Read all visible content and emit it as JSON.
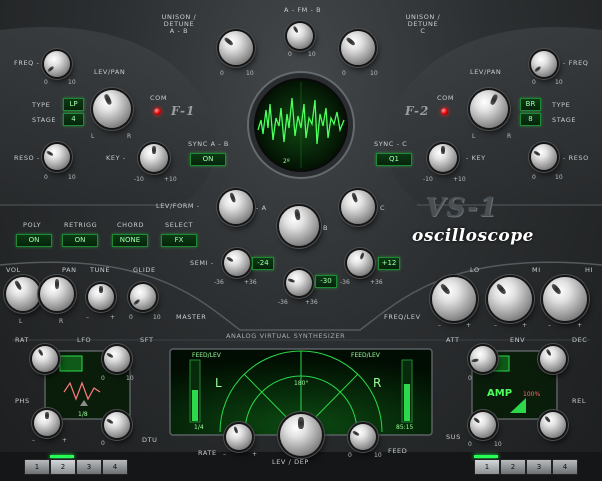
{
  "plugin": {
    "logo": "VS-1",
    "subtitle": "oscilloscope",
    "banner": "ANALOG  VIRTUAL  SYNTHESIZER",
    "scope_readout": "2º"
  },
  "osc": {
    "unison_ab": "UNISON / DETUNE\nA - B",
    "afmb": "A - FM - B",
    "unison_c": "UNISON / DETUNE\nC",
    "sync_ab_label": "SYNC A - B",
    "sync_ab_value": "ON",
    "sync_c_label": "SYNC - C",
    "sync_c_value": "Q1",
    "levform": "LEV/FORM -",
    "a": "- A",
    "b": "B",
    "c": "C",
    "semi": "SEMI -",
    "semi_a": "-24",
    "semi_b": "-30",
    "semi_c": "+12"
  },
  "filter1": {
    "name": "F-1",
    "freq": "FREQ -",
    "levpan": "LEV/PAN",
    "type": "TYPE",
    "stage": "STAGE",
    "type_value": "LP",
    "stage_value": "4",
    "com": "COM",
    "reso": "RESO -",
    "key": "KEY -"
  },
  "filter2": {
    "name": "F-2",
    "freq": "- FREQ",
    "levpan": "LEV/PAN",
    "type": "TYPE",
    "stage": "STAGE",
    "type_value": "BR",
    "stage_value": "8",
    "com": "COM",
    "reso": "- RESO",
    "key": "- KEY"
  },
  "mode": {
    "labels": [
      "POLY",
      "RETRIGG",
      "CHORD",
      "SELECT"
    ],
    "values": [
      "ON",
      "ON",
      "NONE",
      "FX"
    ]
  },
  "master": {
    "vol": "VOL",
    "pan": "PAN",
    "tune": "TUNE",
    "glide": "GLIDE",
    "master": "MASTER"
  },
  "eq": {
    "lo": "LO",
    "mi": "MI",
    "hi": "HI",
    "freqlev": "FREQ/LEV"
  },
  "lfo": {
    "rat": "RAT",
    "lfo": "LFO",
    "sft": "SFT",
    "phs": "PHS",
    "dtu": "DTU",
    "value": "1/8"
  },
  "fx": {
    "feed_l": "FEED/LEV",
    "feed_r": "FEED/LEV",
    "l": "L",
    "r": "R",
    "angle": "180°",
    "val_l": "1/4",
    "val_r": "85:15",
    "rate": "RATE",
    "levdep": "LEV / DEP",
    "feed": "FEED"
  },
  "env": {
    "att": "ATT",
    "env": "ENV",
    "dec": "DEC",
    "rel": "REL",
    "sus": "SUS",
    "amp": "AMP",
    "pct": "100%"
  },
  "tabs_left": [
    "1",
    "2",
    "3",
    "4"
  ],
  "tabs_right": [
    "1",
    "2",
    "3",
    "4"
  ],
  "scales": {
    "z": "0",
    "ten": "10",
    "m10": "-10",
    "p10": "+10",
    "m36": "-36",
    "p36": "+36",
    "m": "–",
    "p": "+",
    "L": "L",
    "R": "R"
  },
  "colors": {
    "accent_green": "#26ff55",
    "led_red": "#e20000",
    "panel": "#2c2f31"
  }
}
